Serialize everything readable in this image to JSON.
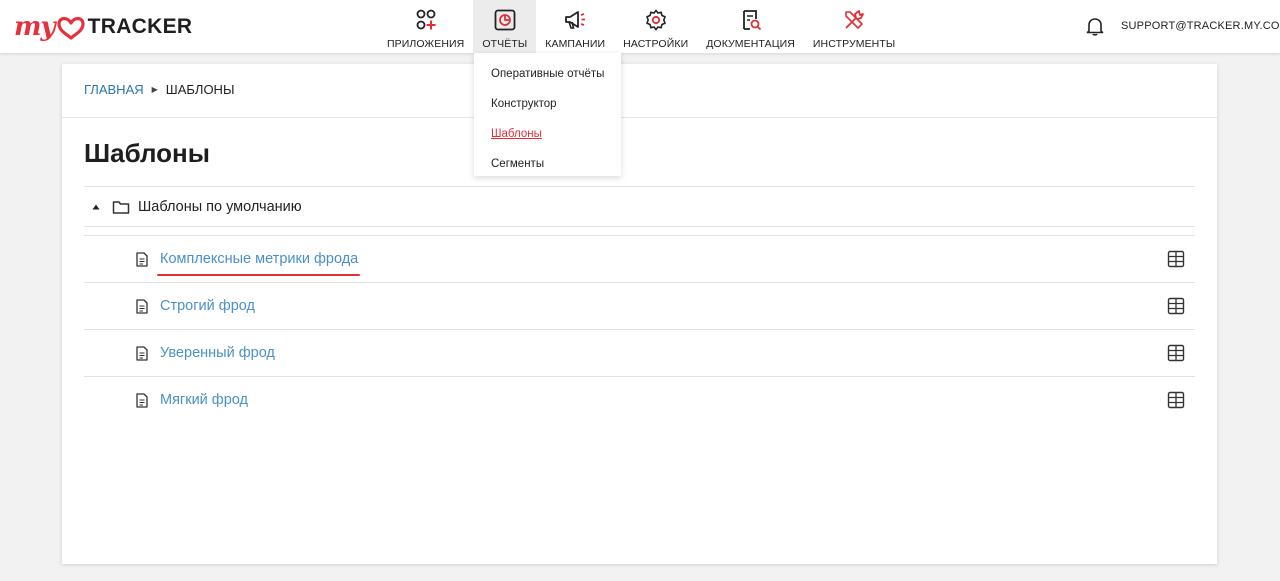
{
  "header": {
    "logo_my": "my",
    "logo_tracker": "TRACKER",
    "support_email": "SUPPORT@TRACKER.MY.COM"
  },
  "nav": {
    "items": [
      {
        "label": "ПРИЛОЖЕНИЯ",
        "icon": "apps-icon"
      },
      {
        "label": "ОТЧЁТЫ",
        "icon": "reports-icon"
      },
      {
        "label": "КАМПАНИИ",
        "icon": "megaphone-icon"
      },
      {
        "label": "НАСТРОЙКИ",
        "icon": "gear-icon"
      },
      {
        "label": "ДОКУМЕНТАЦИЯ",
        "icon": "doc-search-icon"
      },
      {
        "label": "ИНСТРУМЕНТЫ",
        "icon": "tools-icon"
      }
    ]
  },
  "dropdown": {
    "items": [
      {
        "label": "Оперативные отчёты"
      },
      {
        "label": "Конструктор"
      },
      {
        "label": "Шаблоны"
      },
      {
        "label": "Сегменты"
      }
    ]
  },
  "breadcrumb": {
    "home": "ГЛАВНАЯ",
    "current": "ШАБЛОНЫ"
  },
  "page": {
    "title": "Шаблоны",
    "folder_label": "Шаблоны по умолчанию",
    "templates": [
      {
        "label": "Комплексные метрики фрода"
      },
      {
        "label": "Строгий фрод"
      },
      {
        "label": "Уверенный фрод"
      },
      {
        "label": "Мягкий фрод"
      }
    ]
  },
  "colors": {
    "accent_red": "#e0303a",
    "link_blue": "#4a90c8",
    "breadcrumb_blue": "#2b74b4"
  }
}
